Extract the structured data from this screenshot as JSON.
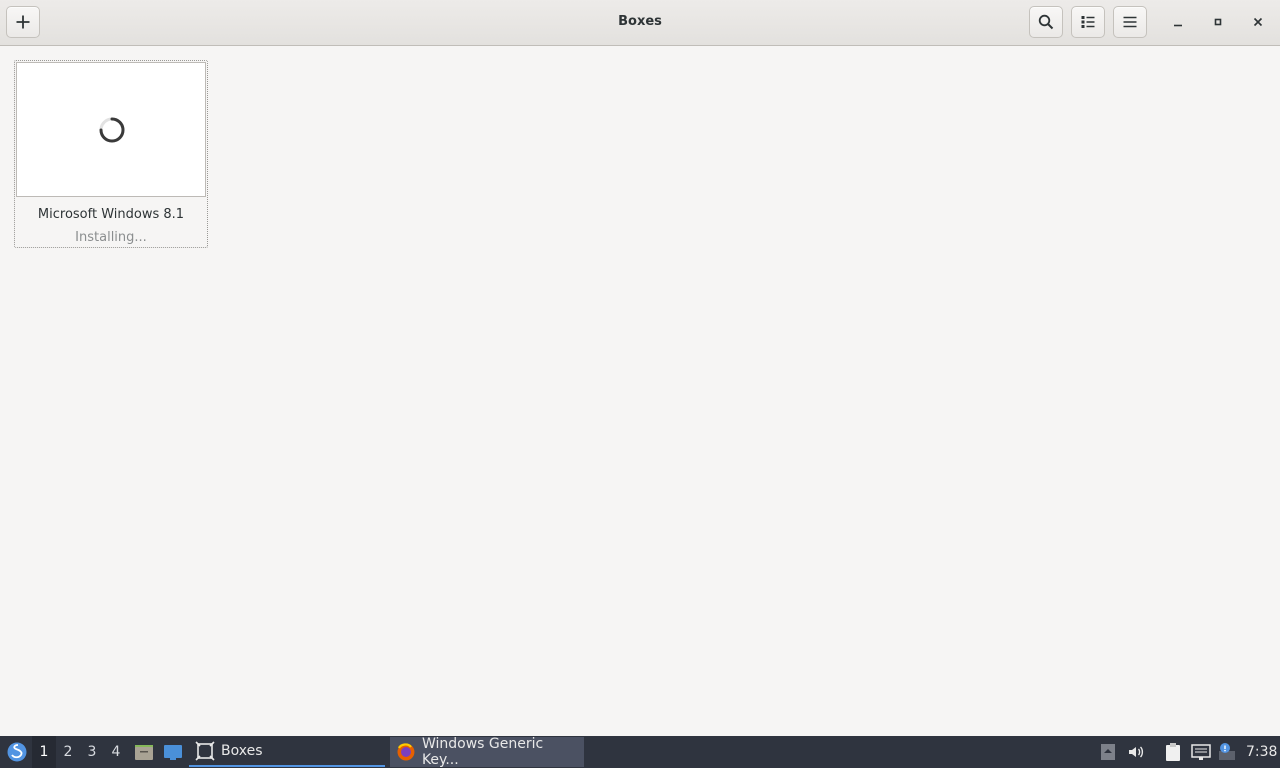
{
  "window": {
    "title": "Boxes"
  },
  "boxes": [
    {
      "name": "Microsoft Windows 8.1",
      "status": "Installing..."
    }
  ],
  "taskbar": {
    "workspaces": [
      "1",
      "2",
      "3",
      "4"
    ],
    "tasks": [
      {
        "label": "Boxes"
      },
      {
        "label": "Windows Generic Key..."
      }
    ],
    "clock": "7:38"
  },
  "colors": {
    "accent": "#5294e2",
    "panel": "#2f343f",
    "background": "#f6f5f4"
  }
}
